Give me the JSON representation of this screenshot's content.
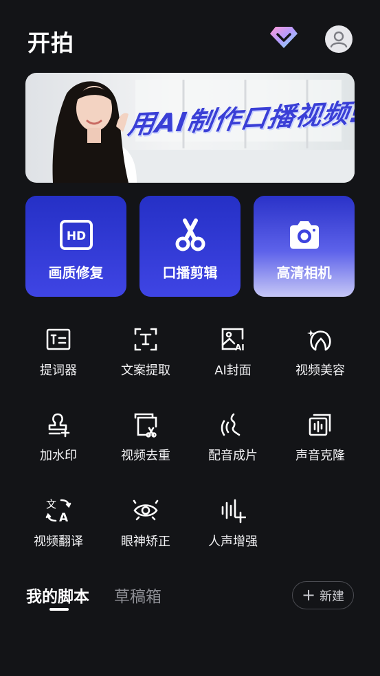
{
  "header": {
    "title": "开拍",
    "vip_icon": "diamond-vip-icon",
    "avatar_icon": "user-avatar-icon"
  },
  "banner": {
    "headline": "用AI制作口播视频!"
  },
  "features": [
    {
      "label": "画质修复",
      "icon": "hd-icon"
    },
    {
      "label": "口播剪辑",
      "icon": "scissors-icon"
    },
    {
      "label": "高清相机",
      "icon": "camera-icon"
    }
  ],
  "tools": [
    {
      "label": "提词器",
      "icon": "teleprompter-icon"
    },
    {
      "label": "文案提取",
      "icon": "text-extract-icon"
    },
    {
      "label": "AI封面",
      "icon": "ai-cover-icon"
    },
    {
      "label": "视频美容",
      "icon": "beauty-icon"
    },
    {
      "label": "加水印",
      "icon": "watermark-icon"
    },
    {
      "label": "视频去重",
      "icon": "dedupe-icon"
    },
    {
      "label": "配音成片",
      "icon": "dubbing-icon"
    },
    {
      "label": "声音克隆",
      "icon": "voice-clone-icon"
    },
    {
      "label": "视频翻译",
      "icon": "translate-icon"
    },
    {
      "label": "眼神矫正",
      "icon": "eye-correction-icon"
    },
    {
      "label": "人声增强",
      "icon": "voice-enhance-icon"
    }
  ],
  "tabs": {
    "active": "我的脚本",
    "inactive": "草稿箱"
  },
  "new_button": {
    "label": "新建",
    "icon": "plus-icon"
  },
  "colors": {
    "background": "#131417",
    "card_blue": "#2f38d8",
    "banner_text": "#3a3fd6"
  }
}
